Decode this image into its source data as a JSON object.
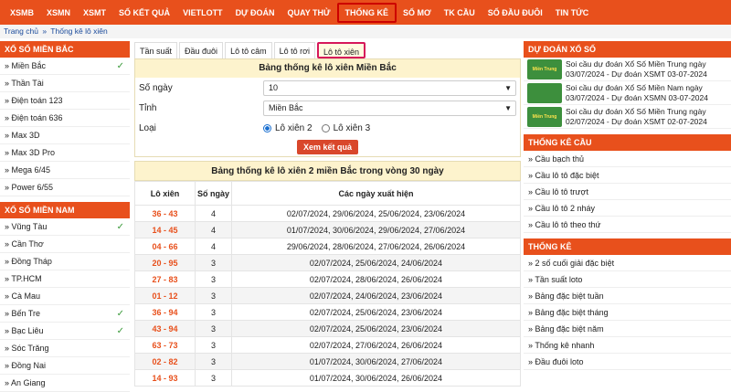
{
  "nav": [
    "XSMB",
    "XSMN",
    "XSMT",
    "SỐ KẾT QUẢ",
    "VIETLOTT",
    "DỰ ĐOÁN",
    "QUAY THỬ",
    "THỐNG KÊ",
    "SỔ MƠ",
    "TK CẦU",
    "SỐ ĐẦU ĐUÔI",
    "TIN TỨC"
  ],
  "breadcrumb": {
    "home": "Trang chủ",
    "sep": "»",
    "current": "Thống kê lô xiên"
  },
  "left": {
    "mb_title": "XỔ SỐ MIỀN BẮC",
    "mb_items": [
      "» Miền Bắc",
      "» Thần Tài",
      "» Điện toán 123",
      "» Điện toán 636",
      "» Max 3D",
      "» Max 3D Pro",
      "» Mega 6/45",
      "» Power 6/55"
    ],
    "mn_title": "XỔ SỐ MIỀN NAM",
    "mn_items": [
      "» Vũng Tàu",
      "» Cần Thơ",
      "» Đồng Tháp",
      "» TP.HCM",
      "» Cà Mau",
      "» Bến Tre",
      "» Bạc Liêu",
      "» Sóc Trăng",
      "» Đồng Nai",
      "» An Giang"
    ],
    "check": "✓"
  },
  "tabs": [
    "Tần suất",
    "Đầu đuôi",
    "Lô tô câm",
    "Lô tô rơi",
    "Lô tô xiên"
  ],
  "form": {
    "title": "Bảng thống kê lô xiên Miền Bắc",
    "days_label": "Số ngày",
    "days_value": "10",
    "province_label": "Tỉnh",
    "province_value": "Miền Bắc",
    "type_label": "Loại",
    "opt1": "Lô xiên 2",
    "opt2": "Lô xiên 3",
    "submit": "Xem kết quả"
  },
  "result": {
    "title": "Bảng thống kê lô xiên 2 miền Bắc trong vòng 30 ngày",
    "headers": [
      "Lô xiên",
      "Số ngày",
      "Các ngày xuất hiện"
    ],
    "rows": [
      [
        "36 - 43",
        "4",
        "02/07/2024, 29/06/2024, 25/06/2024, 23/06/2024"
      ],
      [
        "14 - 45",
        "4",
        "01/07/2024, 30/06/2024, 29/06/2024, 27/06/2024"
      ],
      [
        "04 - 66",
        "4",
        "29/06/2024, 28/06/2024, 27/06/2024, 26/06/2024"
      ],
      [
        "20 - 95",
        "3",
        "02/07/2024, 25/06/2024, 24/06/2024"
      ],
      [
        "27 - 83",
        "3",
        "02/07/2024, 28/06/2024, 26/06/2024"
      ],
      [
        "01 - 12",
        "3",
        "02/07/2024, 24/06/2024, 23/06/2024"
      ],
      [
        "36 - 94",
        "3",
        "02/07/2024, 25/06/2024, 23/06/2024"
      ],
      [
        "43 - 94",
        "3",
        "02/07/2024, 25/06/2024, 23/06/2024"
      ],
      [
        "63 - 73",
        "3",
        "02/07/2024, 27/06/2024, 26/06/2024"
      ],
      [
        "02 - 82",
        "3",
        "01/07/2024, 30/06/2024, 27/06/2024"
      ],
      [
        "14 - 93",
        "3",
        "01/07/2024, 30/06/2024, 26/06/2024"
      ]
    ]
  },
  "right": {
    "predict_title": "DỰ ĐOÁN XỔ SỐ",
    "thumb_text": "Miền Trung",
    "news": [
      "Soi cầu dự đoán Xổ Số Miền Trung ngày 03/07/2024 - Dự đoán XSMT 03-07-2024",
      "Soi cầu dự đoán Xổ Số Miền Nam ngày 03/07/2024 - Dự đoán XSMN 03-07-2024",
      "Soi cầu dự đoán Xổ Số Miền Trung ngày 02/07/2024 - Dự đoán XSMT 02-07-2024"
    ],
    "cau_title": "THỐNG KÊ CẦU",
    "cau_items": [
      "Cầu bạch thủ",
      "Cầu lô tô đặc biệt",
      "Cầu lô tô trượt",
      "Cầu lô tô 2 nháy",
      "Cầu lô tô theo thứ"
    ],
    "tk_title": "THỐNG KÊ",
    "tk_items": [
      "2 số cuối giải đặc biệt",
      "Tần suất loto",
      "Bảng đặc biệt tuần",
      "Bảng đặc biệt tháng",
      "Bảng đặc biệt năm",
      "Thống kê nhanh",
      "Đầu đuôi loto"
    ]
  }
}
